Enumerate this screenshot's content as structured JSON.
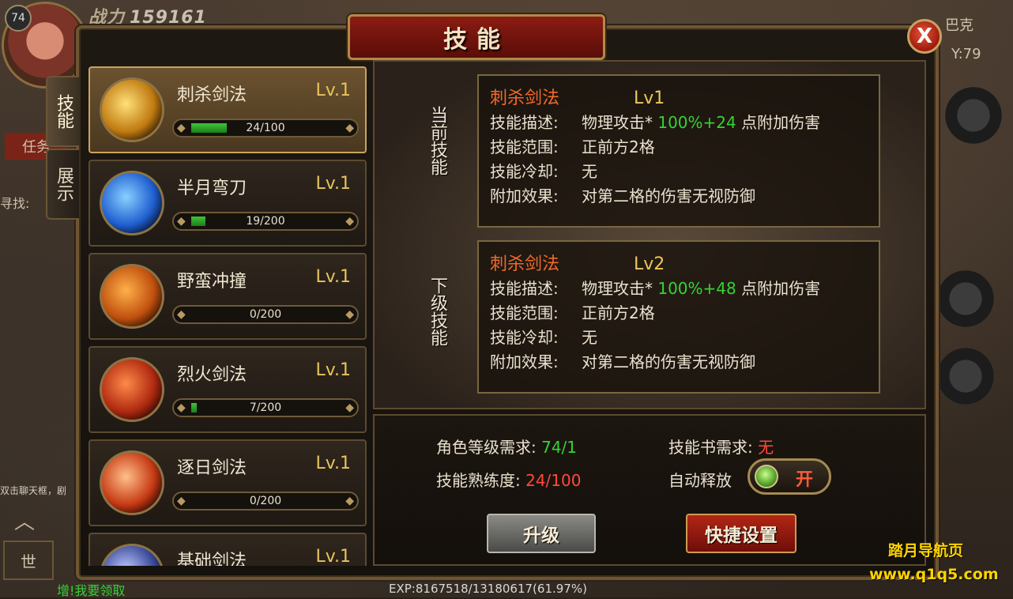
{
  "hud": {
    "player_level": "74",
    "power_label": "战力",
    "power_value": "159161",
    "task_label": "任务",
    "find_label": "寻找:",
    "location_name": "巴克",
    "coord_y": "Y:79",
    "world_channel": "世",
    "chat_line_1": "双击聊天框，剧",
    "chat_line_2": "增!我要领取",
    "exp_text": "EXP:8167518/13180617(61.97%)"
  },
  "panel": {
    "title": "技能",
    "close_symbol": "X"
  },
  "side_tabs": [
    {
      "label": "技能",
      "active": true
    },
    {
      "label": "展示",
      "active": false
    }
  ],
  "skills": [
    {
      "name": "刺杀剑法",
      "level": "Lv.1",
      "progress_text": "24/100",
      "progress": 0.24,
      "icon": "sword-thrust-icon",
      "color": "#d9a22a"
    },
    {
      "name": "半月弯刀",
      "level": "Lv.1",
      "progress_text": "19/200",
      "progress": 0.095,
      "icon": "crescent-blade-icon",
      "color": "#1f6fe0"
    },
    {
      "name": "野蛮冲撞",
      "level": "Lv.1",
      "progress_text": "0/200",
      "progress": 0.0,
      "icon": "charge-runner-icon",
      "color": "#d8661a"
    },
    {
      "name": "烈火剑法",
      "level": "Lv.1",
      "progress_text": "7/200",
      "progress": 0.035,
      "icon": "flame-sword-icon",
      "color": "#c8361a"
    },
    {
      "name": "逐日剑法",
      "level": "Lv.1",
      "progress_text": "0/200",
      "progress": 0.0,
      "icon": "sun-chase-icon",
      "color": "#d8461a"
    },
    {
      "name": "基础剑法",
      "level": "Lv.1",
      "progress_text": "",
      "progress": 0.0,
      "icon": "basic-sword-icon",
      "color": "#4a5a9a"
    }
  ],
  "current_skill": {
    "section_label": "当前技能",
    "name": "刺杀剑法",
    "level": "Lv1",
    "desc_key": "技能描述:",
    "desc_pre": "物理攻击*",
    "desc_value": "100%+24",
    "desc_post": "点附加伤害",
    "range_key": "技能范围:",
    "range_value": "正前方2格",
    "cooldown_key": "技能冷却:",
    "cooldown_value": "无",
    "effect_key": "附加效果:",
    "effect_value": "对第二格的伤害无视防御"
  },
  "next_skill": {
    "section_label": "下级技能",
    "name": "刺杀剑法",
    "level": "Lv2",
    "desc_key": "技能描述:",
    "desc_pre": "物理攻击*",
    "desc_value": "100%+48",
    "desc_post": "点附加伤害",
    "range_key": "技能范围:",
    "range_value": "正前方2格",
    "cooldown_key": "技能冷却:",
    "cooldown_value": "无",
    "effect_key": "附加效果:",
    "effect_value": "对第二格的伤害无视防御"
  },
  "requirements": {
    "role_level_label": "角色等级需求:",
    "role_level_value": "74/1",
    "book_label": "技能书需求:",
    "book_value": "无",
    "proficiency_label": "技能熟练度:",
    "proficiency_value": "24/100",
    "auto_cast_label": "自动释放",
    "auto_cast_state": "开"
  },
  "buttons": {
    "upgrade": "升级",
    "quick_setup": "快捷设置"
  },
  "watermark": {
    "line1": "踏月导航页",
    "line2": "www.q1q5.com"
  },
  "colors": {
    "accent_orange": "#f26a2a",
    "level_gold": "#e8c45c",
    "value_green": "#35d335",
    "value_red": "#ff4a3a"
  }
}
